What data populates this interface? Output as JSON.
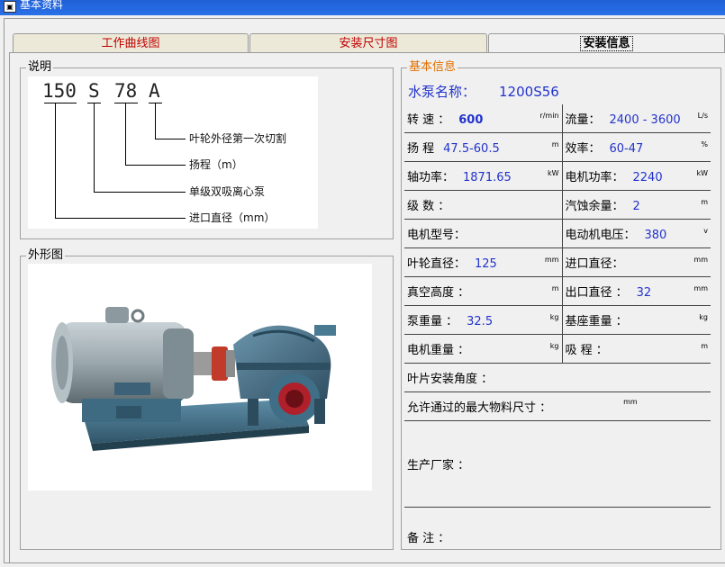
{
  "window": {
    "title": "基本资料"
  },
  "tabs": [
    {
      "label": "工作曲线图"
    },
    {
      "label": "安装尺寸图"
    },
    {
      "label": "安装信息"
    }
  ],
  "description_group": {
    "title": "说明"
  },
  "model_code": {
    "parts": [
      "150",
      "S",
      "78",
      "A"
    ],
    "explanations": [
      "叶轮外径第一次切割",
      "扬程（m）",
      "单级双吸离心泵",
      "进口直径（mm）"
    ]
  },
  "appearance_group": {
    "title": "外形图"
  },
  "basic_info": {
    "title": "基本信息",
    "pump_name_label": "水泵名称：",
    "pump_name_value": "1200S56",
    "rows": [
      {
        "l_label": "转 速 ：",
        "l_value": "600",
        "l_unit": "r/min",
        "r_label": "流量：",
        "r_value": "2400 - 3600",
        "r_unit": "L/s"
      },
      {
        "l_label": "扬 程",
        "l_value": "47.5-60.5",
        "l_unit": "m",
        "r_label": "效率：",
        "r_value": "60-47",
        "r_unit": "%"
      },
      {
        "l_label": "轴功率：",
        "l_value": "1871.65",
        "l_unit": "kW",
        "r_label": "电机功率：",
        "r_value": "2240",
        "r_unit": "kW"
      },
      {
        "l_label": "级 数 ：",
        "l_value": "",
        "l_unit": "",
        "r_label": "汽蚀余量：",
        "r_value": "2",
        "r_unit": "m"
      },
      {
        "l_label": "电机型号：",
        "l_value": "",
        "l_unit": "",
        "r_label": "电动机电压：",
        "r_value": "380",
        "r_unit": "v"
      },
      {
        "l_label": "叶轮直径：",
        "l_value": "125",
        "l_unit": "mm",
        "r_label": "进口直径：",
        "r_value": "",
        "r_unit": "mm"
      },
      {
        "l_label": "真空高度 ：",
        "l_value": "",
        "l_unit": "m",
        "r_label": "出口直径 ：",
        "r_value": "32",
        "r_unit": "mm"
      },
      {
        "l_label": "泵重量 ：",
        "l_value": "32.5",
        "l_unit": "kg",
        "r_label": "基座重量 ：",
        "r_value": "",
        "r_unit": "kg"
      },
      {
        "l_label": "电机重量 ：",
        "l_value": "",
        "l_unit": "kg",
        "r_label": "吸 程 ：",
        "r_value": "",
        "r_unit": "m"
      }
    ],
    "blade_angle_label": "叶片安装角度 ：",
    "max_particle_label": "允许通过的最大物料尺寸 ：",
    "max_particle_unit": "mm",
    "manufacturer_label": "生产厂家 ：",
    "remarks_label": "备 注 ："
  },
  "colors": {
    "tab_text": "#c00000",
    "value_blue": "#2233cc",
    "legend_orange": "#e07000",
    "titlebar": "#2a70e8"
  }
}
